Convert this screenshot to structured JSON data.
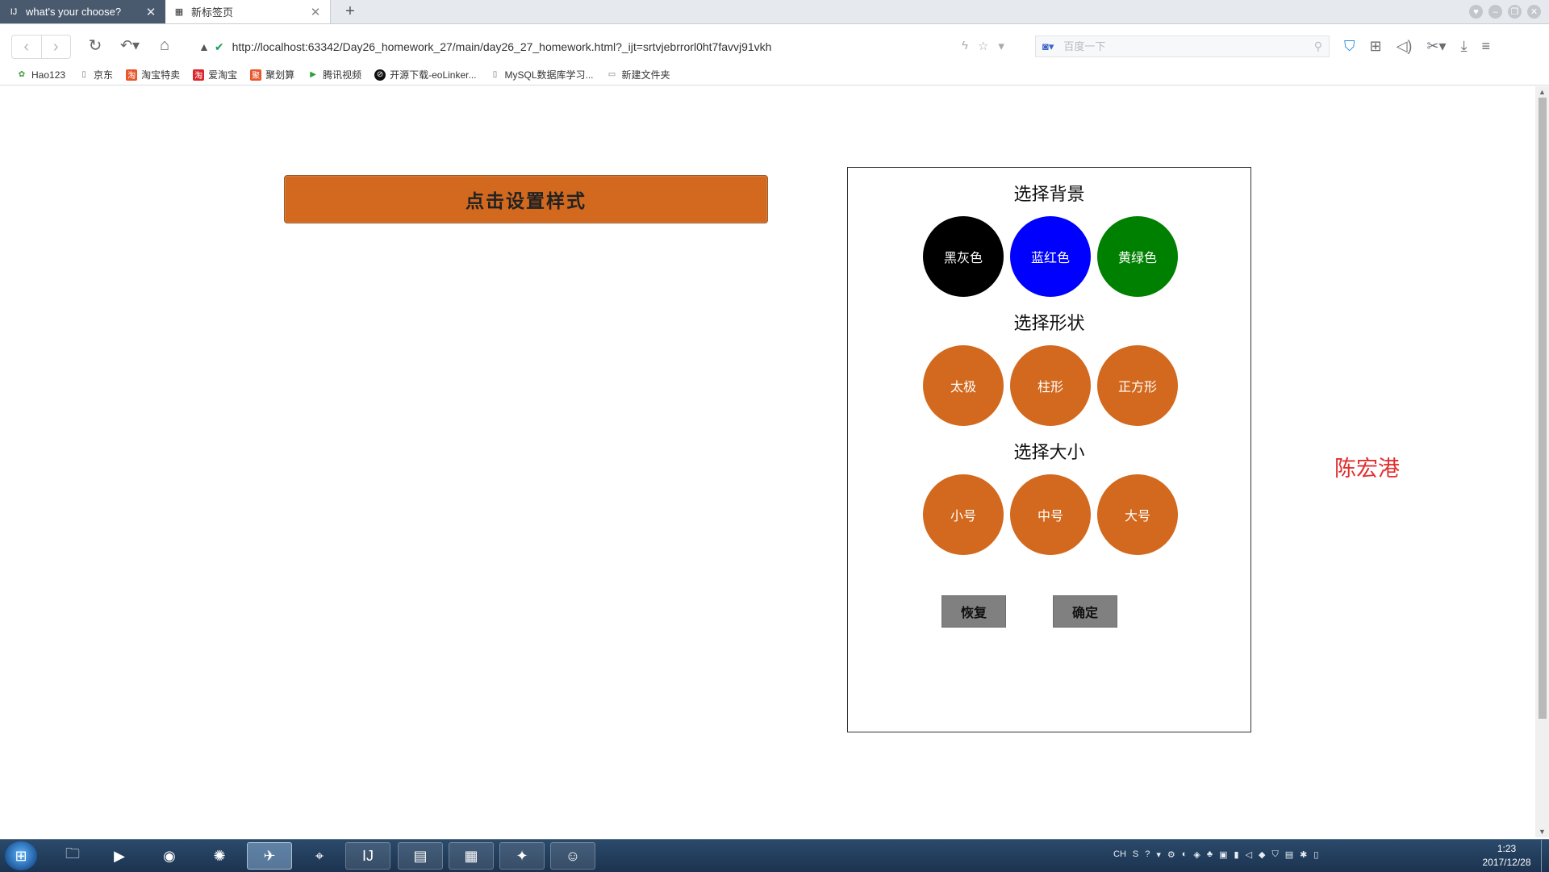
{
  "browser": {
    "tabs": [
      {
        "label": "what's your choose?",
        "active": true
      },
      {
        "label": "新标签页",
        "active": false
      }
    ],
    "url": "http://localhost:63342/Day26_homework_27/main/day26_27_homework.html?_ijt=srtvjebrrorl0ht7favvj91vkh",
    "search_placeholder": "百度一下",
    "bookmarks": [
      "Hao123",
      "京东",
      "淘宝特卖",
      "爱淘宝",
      "聚划算",
      "腾讯视频",
      "开源下载-eoLinker...",
      "MySQL数据库学习...",
      "新建文件夹"
    ]
  },
  "page": {
    "main_button_label": "点击设置样式",
    "sections": {
      "background": {
        "title": "选择背景",
        "options": [
          {
            "label": "黑灰色",
            "color": "#000000"
          },
          {
            "label": "蓝红色",
            "color": "#0000ff"
          },
          {
            "label": "黄绿色",
            "color": "#008000"
          }
        ]
      },
      "shape": {
        "title": "选择形状",
        "options": [
          {
            "label": "太极"
          },
          {
            "label": "柱形"
          },
          {
            "label": "正方形"
          }
        ]
      },
      "size": {
        "title": "选择大小",
        "options": [
          {
            "label": "小号"
          },
          {
            "label": "中号"
          },
          {
            "label": "大号"
          }
        ]
      }
    },
    "reset_label": "恢复",
    "confirm_label": "确定",
    "author": "陈宏港",
    "option_color": "#d2691e",
    "author_color": "#e03030"
  },
  "taskbar": {
    "tray_lang": "CH",
    "time": "1:23",
    "date": "2017/12/28"
  }
}
